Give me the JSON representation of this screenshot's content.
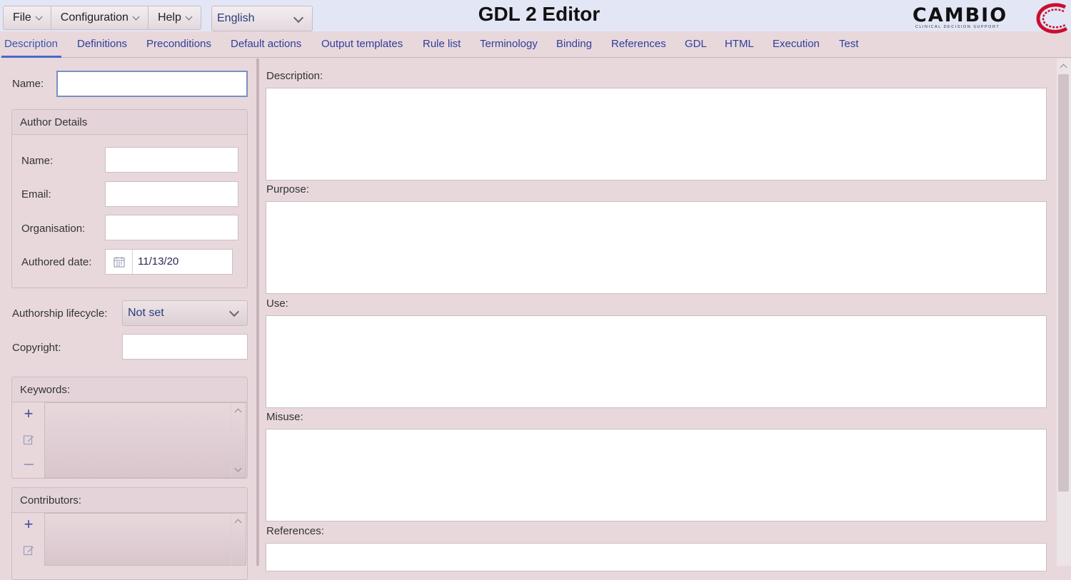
{
  "menu": {
    "file": "File",
    "configuration": "Configuration",
    "help": "Help",
    "language": "English"
  },
  "app": {
    "title": "GDL 2 Editor"
  },
  "logo": {
    "name": "CAMBIO",
    "tagline": "CLINICAL DECISION SUPPORT"
  },
  "colors": {
    "accent": "#3a56b0",
    "logo_red": "#c8102e",
    "background": "#e8d8dc"
  },
  "tabs": [
    {
      "label": "Description"
    },
    {
      "label": "Definitions"
    },
    {
      "label": "Preconditions"
    },
    {
      "label": "Default actions"
    },
    {
      "label": "Output templates"
    },
    {
      "label": "Rule list"
    },
    {
      "label": "Terminology"
    },
    {
      "label": "Binding"
    },
    {
      "label": "References"
    },
    {
      "label": "GDL"
    },
    {
      "label": "HTML"
    },
    {
      "label": "Execution"
    },
    {
      "label": "Test"
    }
  ],
  "active_tab": "Description",
  "left": {
    "name_label": "Name:",
    "name_value": "",
    "author": {
      "title": "Author Details",
      "name_label": "Name:",
      "email_label": "Email:",
      "organisation_label": "Organisation:",
      "date_label": "Authored date:",
      "date_value": "11/13/20"
    },
    "lifecycle_label": "Authorship lifecycle:",
    "lifecycle_value": "Not set",
    "copyright_label": "Copyright:",
    "keywords_label": "Keywords:",
    "contributors_label": "Contributors:"
  },
  "right": {
    "description_label": "Description:",
    "purpose_label": "Purpose:",
    "use_label": "Use:",
    "misuse_label": "Misuse:",
    "references_label": "References:"
  }
}
